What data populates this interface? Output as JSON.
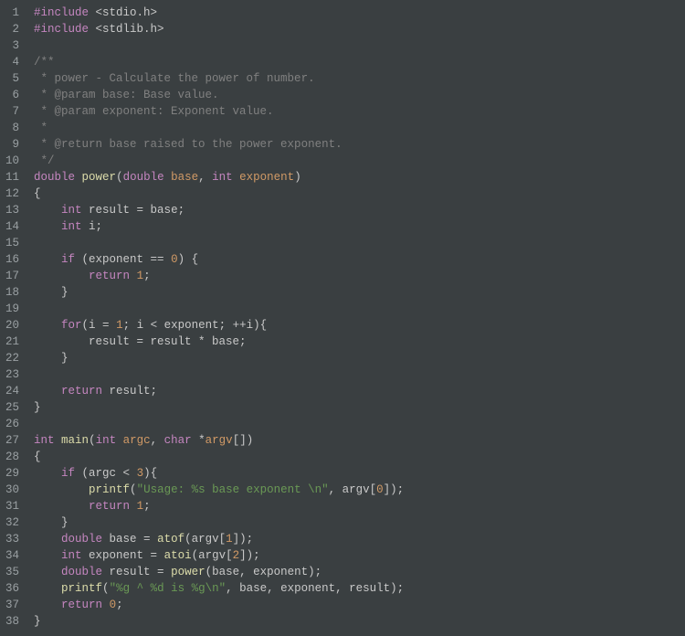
{
  "line_numbers": [
    "1",
    "2",
    "3",
    "4",
    "5",
    "6",
    "7",
    "8",
    "9",
    "10",
    "11",
    "12",
    "13",
    "14",
    "15",
    "16",
    "17",
    "18",
    "19",
    "20",
    "21",
    "22",
    "23",
    "24",
    "25",
    "26",
    "27",
    "28",
    "29",
    "30",
    "31",
    "32",
    "33",
    "34",
    "35",
    "36",
    "37",
    "38"
  ],
  "lines": [
    [
      [
        "preproc",
        "#include"
      ],
      [
        "plain",
        " <stdio.h>"
      ]
    ],
    [
      [
        "preproc",
        "#include"
      ],
      [
        "plain",
        " <stdlib.h>"
      ]
    ],
    [],
    [
      [
        "comment",
        "/**"
      ]
    ],
    [
      [
        "comment",
        " * power - Calculate the power of number."
      ]
    ],
    [
      [
        "comment",
        " * @param base: Base value."
      ]
    ],
    [
      [
        "comment",
        " * @param exponent: Exponent value."
      ]
    ],
    [
      [
        "comment",
        " *"
      ]
    ],
    [
      [
        "comment",
        " * @return base raised to the power exponent."
      ]
    ],
    [
      [
        "comment",
        " */"
      ]
    ],
    [
      [
        "type",
        "double"
      ],
      [
        "plain",
        " "
      ],
      [
        "funcname",
        "power"
      ],
      [
        "plain",
        "("
      ],
      [
        "type",
        "double"
      ],
      [
        "plain",
        " "
      ],
      [
        "param",
        "base"
      ],
      [
        "plain",
        ", "
      ],
      [
        "type",
        "int"
      ],
      [
        "plain",
        " "
      ],
      [
        "param",
        "exponent"
      ],
      [
        "plain",
        ")"
      ]
    ],
    [
      [
        "brace",
        "{"
      ]
    ],
    [
      [
        "plain",
        "    "
      ],
      [
        "type",
        "int"
      ],
      [
        "plain",
        " result = base;"
      ]
    ],
    [
      [
        "plain",
        "    "
      ],
      [
        "type",
        "int"
      ],
      [
        "plain",
        " i;"
      ]
    ],
    [],
    [
      [
        "plain",
        "    "
      ],
      [
        "kw",
        "if"
      ],
      [
        "plain",
        " (exponent == "
      ],
      [
        "num",
        "0"
      ],
      [
        "plain",
        ") {"
      ]
    ],
    [
      [
        "plain",
        "        "
      ],
      [
        "kw",
        "return"
      ],
      [
        "plain",
        " "
      ],
      [
        "num",
        "1"
      ],
      [
        "plain",
        ";"
      ]
    ],
    [
      [
        "plain",
        "    }"
      ]
    ],
    [],
    [
      [
        "plain",
        "    "
      ],
      [
        "kw",
        "for"
      ],
      [
        "plain",
        "(i = "
      ],
      [
        "num",
        "1"
      ],
      [
        "plain",
        "; i < exponent; ++i){"
      ]
    ],
    [
      [
        "plain",
        "        result = result * base;"
      ]
    ],
    [
      [
        "plain",
        "    }"
      ]
    ],
    [],
    [
      [
        "plain",
        "    "
      ],
      [
        "kw",
        "return"
      ],
      [
        "plain",
        " result;"
      ]
    ],
    [
      [
        "brace",
        "}"
      ]
    ],
    [],
    [
      [
        "type",
        "int"
      ],
      [
        "plain",
        " "
      ],
      [
        "funcname",
        "main"
      ],
      [
        "plain",
        "("
      ],
      [
        "type",
        "int"
      ],
      [
        "plain",
        " "
      ],
      [
        "param",
        "argc"
      ],
      [
        "plain",
        ", "
      ],
      [
        "type",
        "char"
      ],
      [
        "plain",
        " *"
      ],
      [
        "param",
        "argv"
      ],
      [
        "plain",
        "[])"
      ]
    ],
    [
      [
        "brace",
        "{"
      ]
    ],
    [
      [
        "plain",
        "    "
      ],
      [
        "kw",
        "if"
      ],
      [
        "plain",
        " (argc < "
      ],
      [
        "num",
        "3"
      ],
      [
        "plain",
        "){"
      ]
    ],
    [
      [
        "plain",
        "        "
      ],
      [
        "call",
        "printf"
      ],
      [
        "plain",
        "("
      ],
      [
        "string",
        "\"Usage: %s base exponent \\n\""
      ],
      [
        "plain",
        ", argv["
      ],
      [
        "num",
        "0"
      ],
      [
        "plain",
        "]);"
      ]
    ],
    [
      [
        "plain",
        "        "
      ],
      [
        "kw",
        "return"
      ],
      [
        "plain",
        " "
      ],
      [
        "num",
        "1"
      ],
      [
        "plain",
        ";"
      ]
    ],
    [
      [
        "plain",
        "    }"
      ]
    ],
    [
      [
        "plain",
        "    "
      ],
      [
        "type",
        "double"
      ],
      [
        "plain",
        " base = "
      ],
      [
        "call",
        "atof"
      ],
      [
        "plain",
        "(argv["
      ],
      [
        "num",
        "1"
      ],
      [
        "plain",
        "]);"
      ]
    ],
    [
      [
        "plain",
        "    "
      ],
      [
        "type",
        "int"
      ],
      [
        "plain",
        " exponent = "
      ],
      [
        "call",
        "atoi"
      ],
      [
        "plain",
        "(argv["
      ],
      [
        "num",
        "2"
      ],
      [
        "plain",
        "]);"
      ]
    ],
    [
      [
        "plain",
        "    "
      ],
      [
        "type",
        "double"
      ],
      [
        "plain",
        " result = "
      ],
      [
        "call",
        "power"
      ],
      [
        "plain",
        "(base, exponent);"
      ]
    ],
    [
      [
        "plain",
        "    "
      ],
      [
        "call",
        "printf"
      ],
      [
        "plain",
        "("
      ],
      [
        "string",
        "\"%g ^ %d is %g\\n\""
      ],
      [
        "plain",
        ", base, exponent, result);"
      ]
    ],
    [
      [
        "plain",
        "    "
      ],
      [
        "kw",
        "return"
      ],
      [
        "plain",
        " "
      ],
      [
        "num",
        "0"
      ],
      [
        "plain",
        ";"
      ]
    ],
    [
      [
        "brace",
        "}"
      ]
    ]
  ]
}
